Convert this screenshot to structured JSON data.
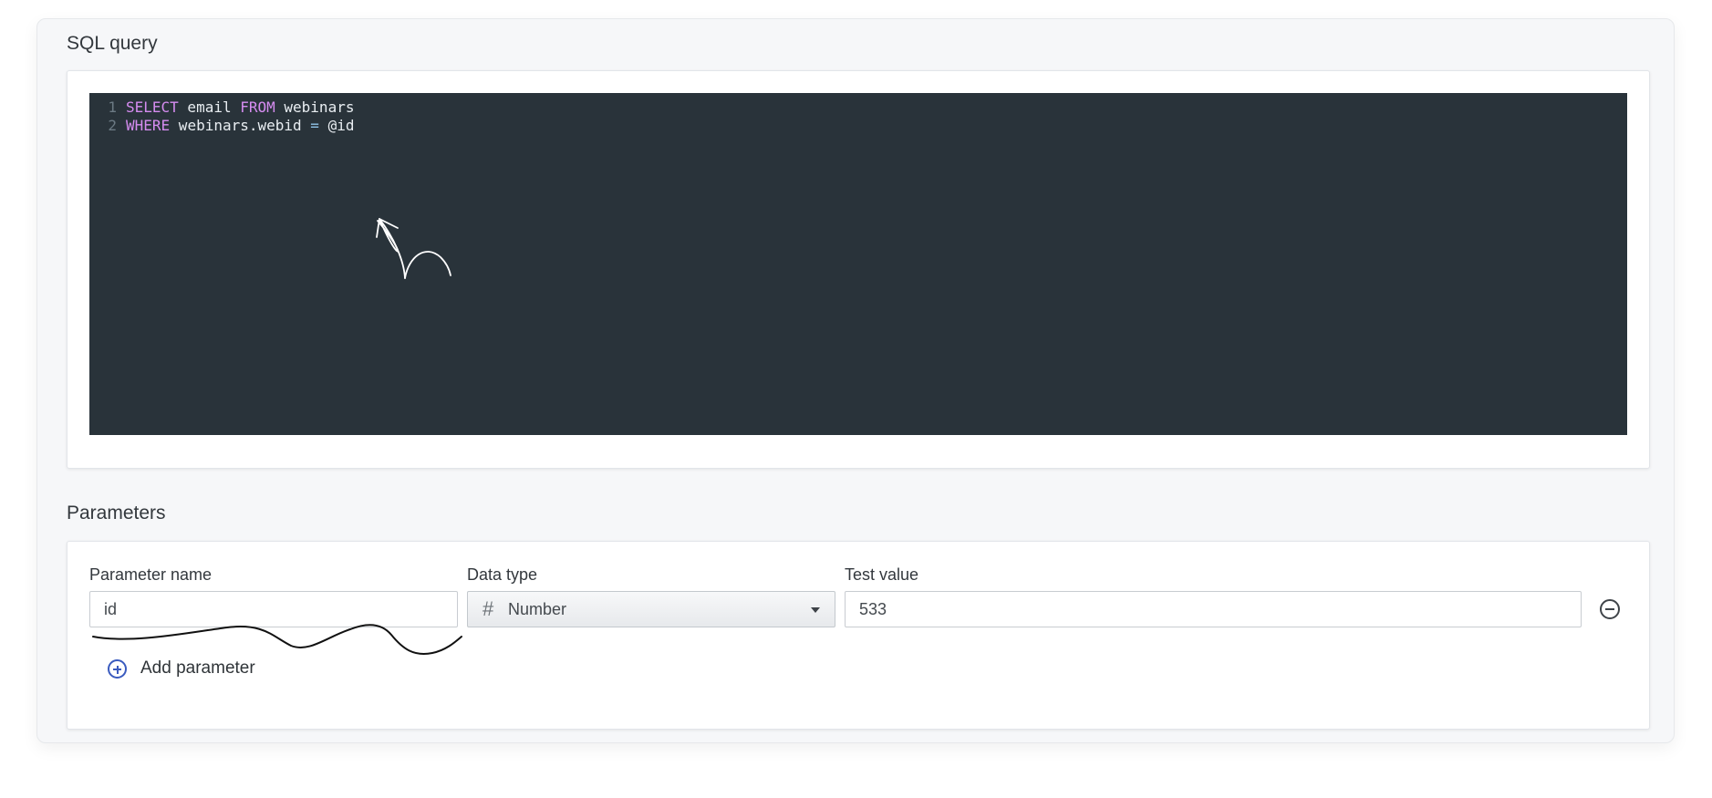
{
  "sql_query": {
    "title": "SQL query",
    "lines": [
      {
        "number": "1",
        "tokens": [
          {
            "type": "keyword",
            "text": "SELECT"
          },
          {
            "type": "plain",
            "text": " email "
          },
          {
            "type": "keyword",
            "text": "FROM"
          },
          {
            "type": "plain",
            "text": " webinars"
          }
        ]
      },
      {
        "number": "2",
        "tokens": [
          {
            "type": "keyword",
            "text": "WHERE"
          },
          {
            "type": "plain",
            "text": " webinars.webid "
          },
          {
            "type": "operator",
            "text": "="
          },
          {
            "type": "plain",
            "text": " @id"
          }
        ]
      }
    ]
  },
  "parameters": {
    "title": "Parameters",
    "column_labels": {
      "name": "Parameter name",
      "type": "Data type",
      "value": "Test value"
    },
    "rows": [
      {
        "name": "id",
        "type_icon": "hash-icon",
        "type": "Number",
        "test_value": "533"
      }
    ],
    "add_label": "Add parameter"
  },
  "colors": {
    "editor_bg": "#29333a",
    "keyword": "#d58cf0",
    "accent": "#3a5bbf"
  }
}
